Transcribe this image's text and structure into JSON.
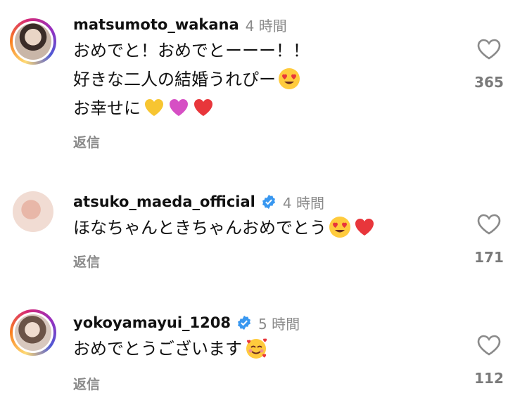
{
  "comments": [
    {
      "username": "matsumoto_wakana",
      "time": "4 時間",
      "lines": [
        "おめでと！おめでとーーー！！",
        "好きな二人の結婚うれぴー",
        "お幸せに"
      ],
      "reply": "返信",
      "likes": "365",
      "verified": false,
      "story_ring": true,
      "emojis": [
        "heart-eyes-emoji",
        "yellow-heart-emoji",
        "pink-heart-emoji",
        "red-heart-emoji"
      ]
    },
    {
      "username": "atsuko_maeda_official",
      "time": "4 時間",
      "lines": [
        "ほなちゃんときちゃんおめでとう"
      ],
      "reply": "返信",
      "likes": "171",
      "verified": true,
      "story_ring": false,
      "emojis": [
        "heart-eyes-emoji",
        "red-heart-emoji"
      ]
    },
    {
      "username": "yokoyamayui_1208",
      "time": "5 時間",
      "lines": [
        "おめでとうございます"
      ],
      "reply": "返信",
      "likes": "112",
      "verified": true,
      "story_ring": true,
      "emojis": [
        "smiling-face-with-hearts-emoji"
      ]
    }
  ],
  "colors": {
    "text": "#111111",
    "secondary": "#8a8a8a",
    "verified": "#3897f0",
    "heart_red": "#e8363b",
    "heart_yellow": "#f7c531",
    "heart_pink": "#d64fc4"
  }
}
